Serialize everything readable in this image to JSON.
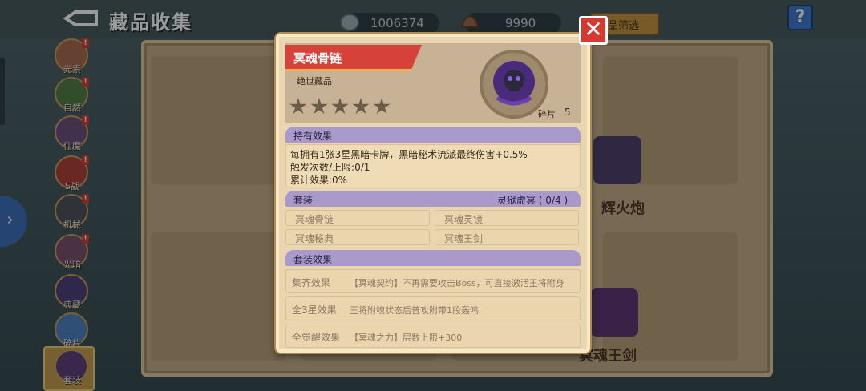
{
  "header": {
    "title": "藏品收集",
    "currency_1": "1006374",
    "currency_2": "9990",
    "filter_label": "品筛选",
    "help_label": "?"
  },
  "sidebar": {
    "expand_arrow": "›",
    "categories": [
      {
        "label": "元素",
        "badge": "!"
      },
      {
        "label": "自然",
        "badge": "!"
      },
      {
        "label": "仙魔",
        "badge": "!"
      },
      {
        "label": "S战",
        "badge": "!"
      },
      {
        "label": "机械",
        "badge": "!"
      },
      {
        "label": "光暗",
        "badge": "!"
      },
      {
        "label": "典藏",
        "badge": ""
      },
      {
        "label": "碎片",
        "badge": ""
      },
      {
        "label": "套装",
        "badge": ""
      }
    ]
  },
  "background_cards": {
    "labels": [
      "辉火炮",
      "冥魂王剑"
    ]
  },
  "modal": {
    "item_name": "冥魂骨链",
    "rarity": "绝世藏品",
    "stars_total": 5,
    "stars_filled": 0,
    "fragments_label": "碎片",
    "fragments_count": "5",
    "holding_effect": {
      "title": "持有效果",
      "lines": [
        "每拥有1张3星黑暗卡牌，黑暗秘术流派最终伤害+0.5%",
        "触发次数/上限:0/1",
        "累计效果:0%"
      ]
    },
    "set": {
      "title": "套装",
      "set_name": "灵狱虚冥 ( 0/4 )",
      "items": [
        "冥魂骨链",
        "冥魂灵镜",
        "冥魂秘典",
        "冥魂王剑"
      ]
    },
    "set_effects": {
      "title": "套装效果",
      "rows": [
        {
          "label": "集齐效果",
          "desc": "【冥魂契约】不再需要攻击Boss，可直接激活王将附身"
        },
        {
          "label": "全3星效果",
          "desc": "王将附魂状态后普攻附带1段轰鸣"
        },
        {
          "label": "全觉醒效果",
          "desc": "【冥魂之力】层数上限+300"
        }
      ]
    },
    "close_label": "✕"
  }
}
